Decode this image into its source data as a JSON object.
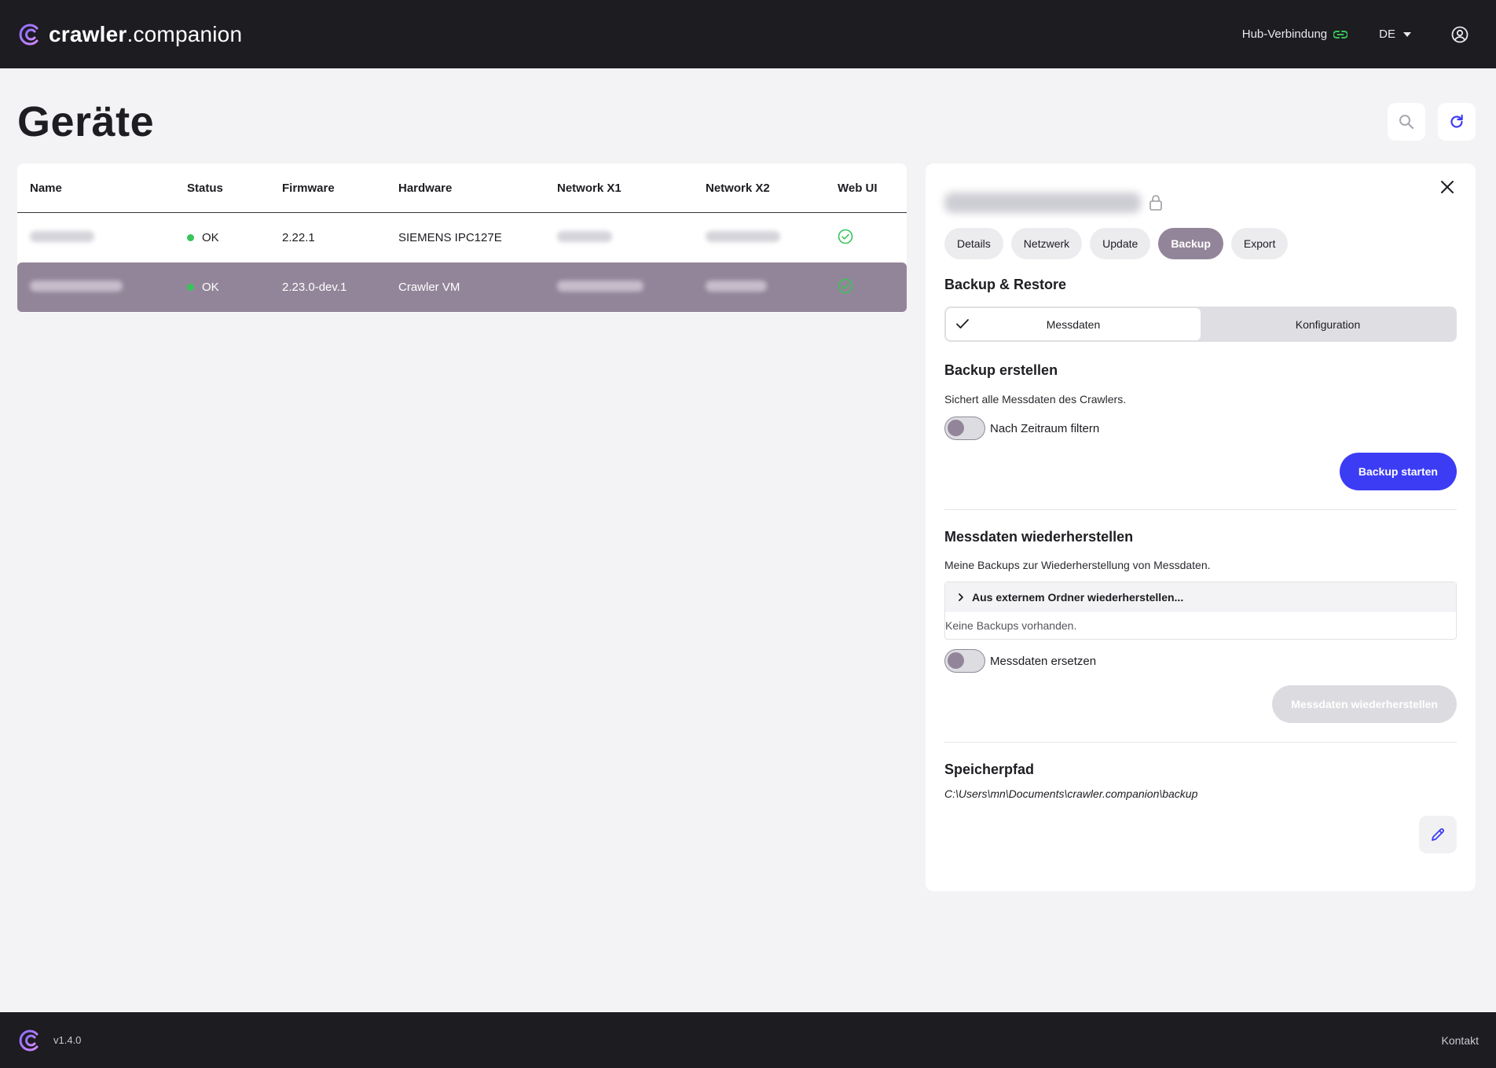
{
  "app": {
    "logo_bold": "crawler",
    "logo_light": ".companion",
    "hub_label": "Hub-Verbindung",
    "language": "DE",
    "version": "v1.4.0",
    "contact": "Kontakt"
  },
  "page": {
    "title": "Geräte"
  },
  "table": {
    "columns": [
      "Name",
      "Status",
      "Firmware",
      "Hardware",
      "Network X1",
      "Network X2",
      "Web UI"
    ],
    "rows": [
      {
        "status": "OK",
        "firmware": "2.22.1",
        "hardware": "SIEMENS IPC127E"
      },
      {
        "status": "OK",
        "firmware": "2.23.0-dev.1",
        "hardware": "Crawler VM"
      }
    ]
  },
  "panel": {
    "tabs": [
      "Details",
      "Netzwerk",
      "Update",
      "Backup",
      "Export"
    ],
    "active_tab": "Backup",
    "section_title": "Backup & Restore",
    "segments": [
      "Messdaten",
      "Konfiguration"
    ],
    "backup": {
      "title": "Backup erstellen",
      "description": "Sichert alle Messdaten des Crawlers.",
      "toggle_label": "Nach Zeitraum filtern",
      "button": "Backup starten"
    },
    "restore": {
      "title": "Messdaten wiederherstellen",
      "description": "Meine Backups zur Wiederherstellung von Messdaten.",
      "accordion_label": "Aus externem Ordner wiederherstellen...",
      "empty_text": "Keine Backups vorhanden.",
      "toggle_label": "Messdaten ersetzen",
      "button": "Messdaten wiederherstellen"
    },
    "storage": {
      "title": "Speicherpfad",
      "path": "C:\\Users\\mn\\Documents\\crawler.companion\\backup"
    }
  },
  "colors": {
    "accent": "#3c3cf5",
    "selected_row": "#938599",
    "status_ok": "#39c45a"
  }
}
